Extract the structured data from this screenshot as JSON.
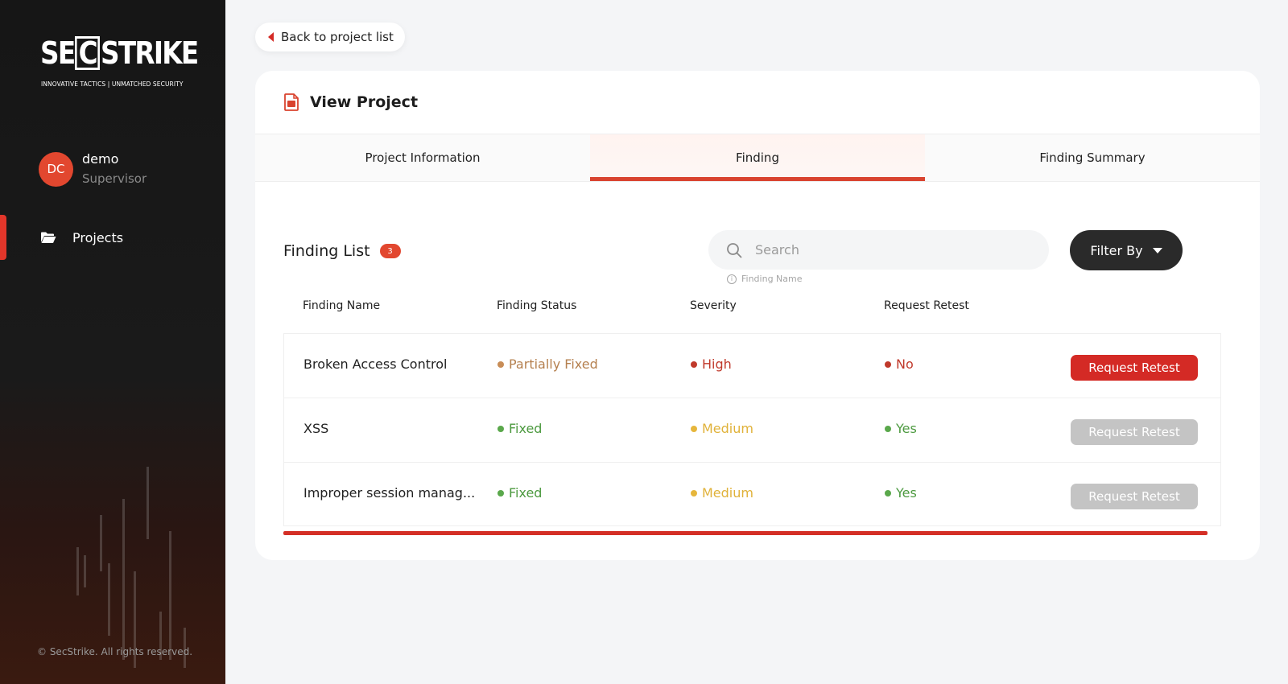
{
  "brand": {
    "logo_prefix": "SE",
    "logo_boxed": "C",
    "logo_suffix": "STRIKE",
    "tagline": "INNOVATIVE TACTICS | UNMATCHED SECURITY"
  },
  "user": {
    "initials": "DC",
    "name": "demo",
    "role": "Supervisor"
  },
  "sidebar": {
    "items": [
      {
        "label": "Projects",
        "icon": "folder-open-icon",
        "active": true
      }
    ],
    "copyright": "© SecStrike. All rights reserved."
  },
  "back_button": {
    "label": "Back to project list"
  },
  "page": {
    "title": "View Project"
  },
  "tabs": [
    {
      "label": "Project Information",
      "active": false
    },
    {
      "label": "Finding",
      "active": true
    },
    {
      "label": "Finding Summary",
      "active": false
    }
  ],
  "finding_list": {
    "title": "Finding List",
    "count": "3",
    "search": {
      "placeholder": "Search",
      "value": "",
      "hint": "Finding Name"
    },
    "filter_label": "Filter By",
    "columns": [
      "Finding Name",
      "Finding Status",
      "Severity",
      "Request Retest"
    ],
    "rows": [
      {
        "name": "Broken Access Control",
        "status": "Partially Fixed",
        "severity": "High",
        "retest": "No",
        "action": "Request Retest"
      },
      {
        "name": "XSS",
        "status": "Fixed",
        "severity": "Medium",
        "retest": "Yes",
        "action": "Request Retest"
      },
      {
        "name": "Improper session manag...",
        "status": "Fixed",
        "severity": "Medium",
        "retest": "Yes",
        "action": "Request Retest"
      }
    ]
  },
  "colors": {
    "accent": "#d42a25",
    "status_partial": "#b5804f",
    "status_fixed": "#5aa84b",
    "severity_high": "#c0392b",
    "severity_medium": "#e6b63c",
    "retest_no": "#c0392b",
    "retest_yes": "#5aa84b",
    "button_disabled": "#c4c4c4"
  }
}
